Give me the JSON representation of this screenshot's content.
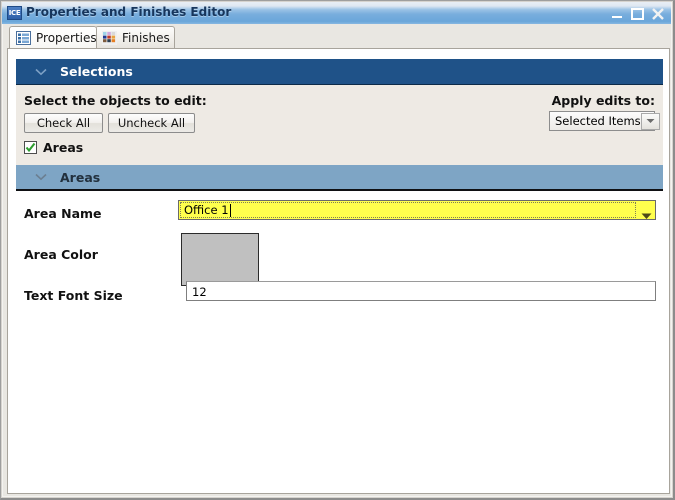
{
  "window": {
    "title": "Properties and Finishes Editor",
    "icon_label": "ICE",
    "icon_name": "app-icon",
    "controls": {
      "minimize": "minimize-icon",
      "maximize": "maximize-icon",
      "close": "close-icon"
    }
  },
  "tabs": [
    {
      "label": "Properties",
      "icon": "list-icon",
      "selected": true
    },
    {
      "label": "Finishes",
      "icon": "color-palette-icon",
      "selected": false
    }
  ],
  "selections": {
    "header_title": "Selections",
    "collapse_icon": "chevron-down-icon",
    "prompt": "Select the objects to edit:",
    "check_all_label": "Check All",
    "uncheck_all_label": "Uncheck All",
    "apply_label": "Apply edits to:",
    "apply_value": "Selected Items",
    "apply_options": [
      "Selected Items"
    ],
    "checkboxes": [
      {
        "label": "Areas",
        "checked": true
      }
    ]
  },
  "areas": {
    "header_title": "Areas",
    "collapse_icon": "chevron-down-icon",
    "fields": {
      "area_name_label": "Area Name",
      "area_name_value": "Office 1",
      "area_color_label": "Area Color",
      "area_color_value": "#c0c0c0",
      "font_size_label": "Text Font Size",
      "font_size_value": "12"
    }
  },
  "colors": {
    "titlebar_blue": "#6aa6da",
    "section_dark": "#1f5288",
    "section_light": "#7ea5c5",
    "panel_cream": "#eeeae4",
    "focus_yellow": "#ffff4d",
    "swatch_gray": "#c0c0c0"
  }
}
